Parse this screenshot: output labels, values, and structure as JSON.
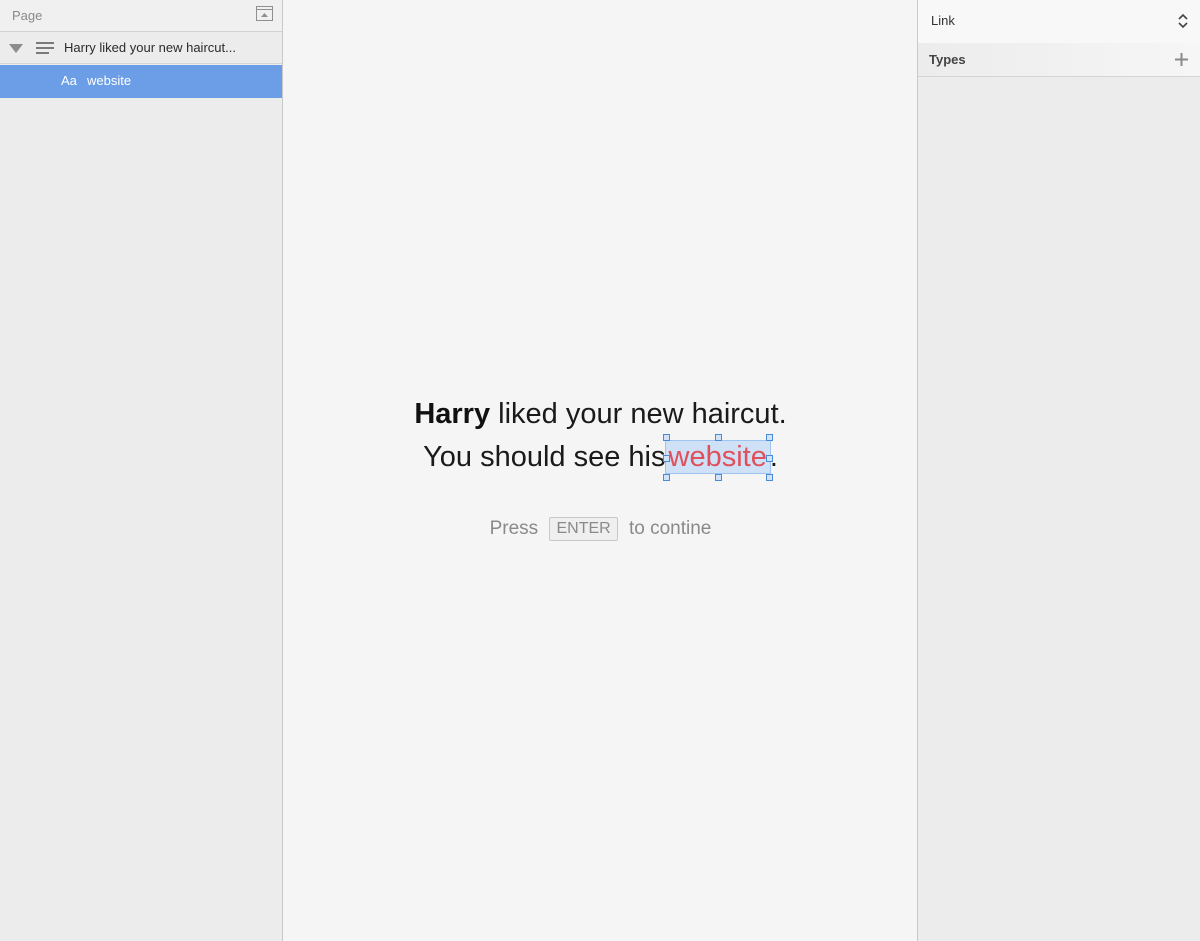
{
  "sidebar": {
    "title": "Page",
    "tree": {
      "parent_label": "Harry liked your new haircut...",
      "child_icon": "Aa",
      "child_label": "website"
    }
  },
  "canvas": {
    "line1_bold": "Harry",
    "line1_rest": " liked your new haircut.",
    "line2_pre": "You should see his",
    "link_word": "website",
    "line2_post": ".",
    "prompt_pre": "Press",
    "prompt_key": "ENTER",
    "prompt_post": "to contine"
  },
  "inspector": {
    "select_value": "Link",
    "types_label": "Types"
  },
  "colors": {
    "selection_row": "#6b9ee6",
    "link_text": "#e0505a",
    "link_highlight": "#cfe1f7"
  },
  "icons": [
    "collapse-panel-icon",
    "disclosure-triangle-icon",
    "paragraph-lines-icon",
    "text-layer-icon",
    "stepper-chevrons-icon",
    "plus-icon"
  ]
}
